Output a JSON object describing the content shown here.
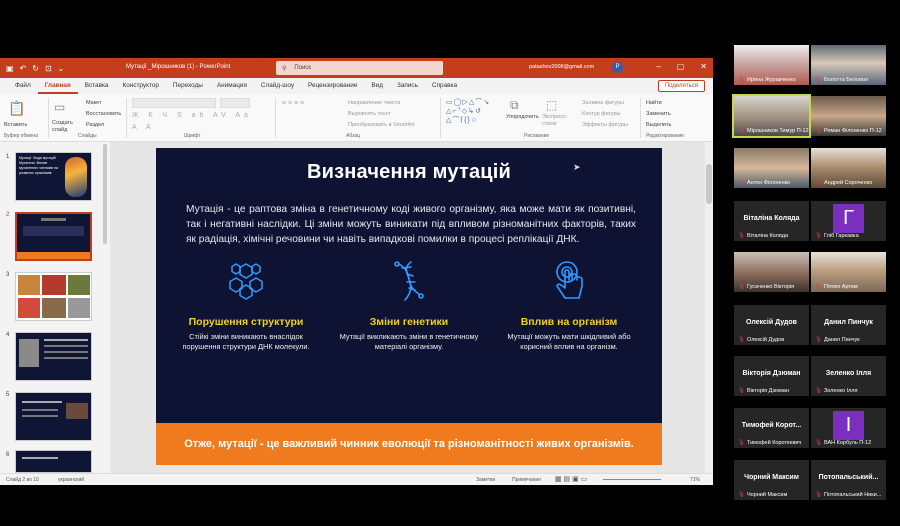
{
  "ppt": {
    "doc_title": "Мутації _Мірошников (1)  -  PowerPoint",
    "search_placeholder": "Поиск",
    "user": "patashov2008@gmail.com",
    "avatar_letter": "P",
    "tabs": [
      "Файл",
      "Главная",
      "Вставка",
      "Конструктор",
      "Переходы",
      "Анимация",
      "Слайд-шоу",
      "Рецензирование",
      "Вид",
      "Запись",
      "Справка"
    ],
    "share_label": "Поделиться",
    "ribbon": {
      "paste": "Вставить",
      "new_slide": "Создать слайд",
      "layout": "Макет",
      "reset": "Восстановить",
      "sections": "Раздел",
      "text_direction": "Направление текста",
      "align_text": "Выровнять текст",
      "smartart": "Преобразовать в SmartArt",
      "arrange": "Упорядочить",
      "quick_styles": "Экспресс-стили",
      "fill": "Заливка фигуры",
      "outline": "Контур фигуры",
      "effects": "Эффекты фигуры",
      "find": "Найти",
      "replace": "Заменить",
      "select": "Выделить",
      "groups": [
        "Буфер обмена",
        "Слайды",
        "Шрифт",
        "Абзац",
        "Рисование",
        "Редактирование"
      ]
    },
    "slide": {
      "title": "Визначення мутацій",
      "text": "Мутація - це раптова зміна в генетичному коді живого організму, яка може мати як позитивні, так і негативні наслідки. Ці зміни можуть виникати під впливом різноманітних факторів, таких як радіація, хімічні речовини чи навіть випадкові помилки в процесі реплікації ДНК.",
      "features": [
        {
          "icon": "hexagon-cluster-icon",
          "title": "Порушення структури",
          "desc": "Стійкі зміни виникають внаслідок порушення структури ДНК молекули."
        },
        {
          "icon": "dna-icon",
          "title": "Зміни генетики",
          "desc": "Мутації викликають зміни в генетичному матеріалі організму."
        },
        {
          "icon": "hand-pointer-icon",
          "title": "Вплив на організм",
          "desc": "Мутації можуть мати шкідливий або корисний вплив на організм."
        }
      ],
      "footer": "Отже, мутації - це важливий чинник еволюції та різноманітності живих організмів."
    },
    "thumb_numbers": [
      "1",
      "2",
      "3",
      "4",
      "5",
      "6"
    ],
    "thumb1_title": "Мутації. Види мутацій. Мутагени. Вплив мутагенних чинників на розвиток організмів",
    "status": {
      "slide_info": "Слайд 2 из 10",
      "language": "украинский",
      "notes": "Заметки",
      "comments": "Примечания",
      "zoom": "71%"
    },
    "colors": {
      "accent": "#c43e1c",
      "slide_bg": "#0e1233",
      "slide_yellow": "#f2d21c",
      "slide_orange": "#ef7b1e"
    }
  },
  "participants": [
    {
      "name": "Ирина Журавченко",
      "type": "video"
    },
    {
      "name": "Болотта Беловол",
      "type": "video"
    },
    {
      "name": "Мірошников Тимур П-12",
      "type": "video"
    },
    {
      "name": "Роман Філоненко П-12",
      "type": "video"
    },
    {
      "name": "Антон Філоненко",
      "type": "video"
    },
    {
      "name": "Андрей Сороченко",
      "type": "video"
    },
    {
      "name": "Віталіна Коляда",
      "center": "Віталіна Коляда",
      "type": "text"
    },
    {
      "name": "Гліб Гаркавка",
      "letter": "Г",
      "type": "avatar"
    },
    {
      "name": "Гусаченко Вікторія",
      "type": "video"
    },
    {
      "name": "Пятюх Артем",
      "type": "video"
    },
    {
      "name": "Олексій Дудов",
      "center": "Олексій Дудов",
      "type": "text"
    },
    {
      "name": "Данил Пинчук",
      "center": "Данил Пинчук",
      "type": "text"
    },
    {
      "name": "Вікторія Дзюман",
      "center": "Вікторія Дзюман",
      "type": "text"
    },
    {
      "name": "Зеленко Ілля",
      "center": "Зеленко Ілля",
      "type": "text"
    },
    {
      "name": "Тимофей Короткевич",
      "center": "Тимофей Корот...",
      "type": "text"
    },
    {
      "name": "ВАН Корбуль П-12",
      "letter": "І",
      "type": "avatar"
    },
    {
      "name": "Чорний Максим",
      "center": "Чорний Максим",
      "type": "text"
    },
    {
      "name": "Потопальський Ники...",
      "center": "Потопальський...",
      "type": "text"
    }
  ]
}
